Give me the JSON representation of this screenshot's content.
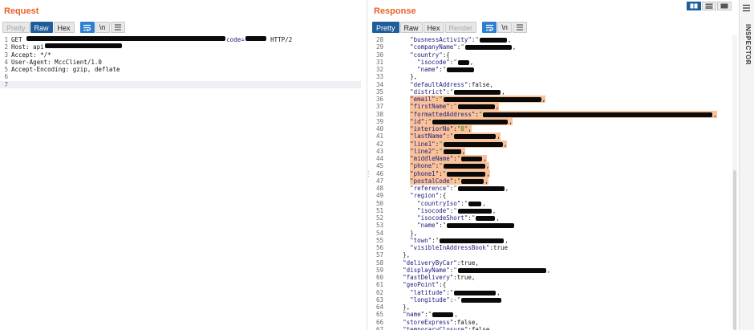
{
  "request": {
    "title": "Request",
    "tabs": {
      "pretty": "Pretty",
      "raw": "Raw",
      "hex": "Hex",
      "newline": "\\n"
    },
    "lines": [
      {
        "n": "1",
        "a": "GET ",
        "b": "code=",
        "c": " HTTP/2"
      },
      {
        "n": "2",
        "a": "Host: api"
      },
      {
        "n": "3",
        "a": "Accept: */*"
      },
      {
        "n": "4",
        "a": "User-Agent: MccClient/1.0"
      },
      {
        "n": "5",
        "a": "Accept-Encoding: gzip, deflate"
      },
      {
        "n": "6",
        "a": ""
      },
      {
        "n": "7",
        "a": ""
      }
    ]
  },
  "response": {
    "title": "Response",
    "tabs": {
      "pretty": "Pretty",
      "raw": "Raw",
      "hex": "Hex",
      "render": "Render",
      "newline": "\\n"
    },
    "lines": [
      {
        "n": "28",
        "indent": "      ",
        "k": "\"busnessActivity\"",
        "sep": ":",
        "r": 34,
        "e": ","
      },
      {
        "n": "29",
        "indent": "      ",
        "k": "\"companyName\"",
        "sep": ":",
        "r": 58,
        "e": ","
      },
      {
        "n": "30",
        "indent": "      ",
        "k": "\"country\"",
        "sep": ":{",
        "r": 0,
        "e": ""
      },
      {
        "n": "31",
        "indent": "        ",
        "k": "\"isocode\"",
        "sep": ":",
        "r": 14,
        "e": ","
      },
      {
        "n": "32",
        "indent": "        ",
        "k": "\"name\"",
        "sep": ":",
        "r": 34,
        "e": ""
      },
      {
        "n": "33",
        "indent": "      ",
        "k": "",
        "sep": "},",
        "r": 0,
        "e": ""
      },
      {
        "n": "34",
        "indent": "      ",
        "k": "\"defaultAddress\"",
        "sep": ":false,",
        "r": 0,
        "e": ""
      },
      {
        "n": "35",
        "indent": "      ",
        "k": "\"district\"",
        "sep": ":",
        "r": 58,
        "e": ","
      },
      {
        "n": "36",
        "indent": "      ",
        "k": "\"email\"",
        "sep": ":",
        "r": 122,
        "e": ",",
        "hl": true
      },
      {
        "n": "37",
        "indent": "      ",
        "k": "\"firstName\"",
        "sep": ":",
        "r": 46,
        "e": ",",
        "hl": true
      },
      {
        "n": "38",
        "indent": "      ",
        "k": "\"formattedAddress\"",
        "sep": ":",
        "r": 286,
        "e": ",",
        "hl": true
      },
      {
        "n": "39",
        "indent": "      ",
        "k": "\"id\"",
        "sep": ":",
        "r": 94,
        "e": ",",
        "hl": true
      },
      {
        "n": "40",
        "indent": "      ",
        "k": "\"interiorNo\"",
        "sep": ":",
        "v": "\"0\"",
        "r": 0,
        "e": ",",
        "hl": true
      },
      {
        "n": "41",
        "indent": "      ",
        "k": "\"lastName\"",
        "sep": ":",
        "r": 52,
        "e": ",",
        "hl": true
      },
      {
        "n": "42",
        "indent": "      ",
        "k": "\"line1\"",
        "sep": ":",
        "r": 74,
        "e": ",",
        "hl": true
      },
      {
        "n": "43",
        "indent": "      ",
        "k": "\"line2\"",
        "sep": ":",
        "r": 22,
        "e": ",",
        "hl": true
      },
      {
        "n": "44",
        "indent": "      ",
        "k": "\"middleName\"",
        "sep": ":",
        "r": 26,
        "e": ",",
        "hl": true
      },
      {
        "n": "45",
        "indent": "      ",
        "k": "\"phone\"",
        "sep": ":",
        "r": 52,
        "e": ",",
        "hl": true
      },
      {
        "n": "46",
        "indent": "      ",
        "k": "\"phone1\"",
        "sep": ":",
        "r": 48,
        "e": ",",
        "hl": true
      },
      {
        "n": "47",
        "indent": "      ",
        "k": "\"postalCode\"",
        "sep": ":",
        "r": 28,
        "e": ",",
        "hl": true
      },
      {
        "n": "48",
        "indent": "      ",
        "k": "\"reference\"",
        "sep": ":",
        "r": 58,
        "e": ","
      },
      {
        "n": "49",
        "indent": "      ",
        "k": "\"region\"",
        "sep": ":{",
        "r": 0,
        "e": ""
      },
      {
        "n": "50",
        "indent": "        ",
        "k": "\"countryIso\"",
        "sep": ":",
        "r": 16,
        "e": ","
      },
      {
        "n": "51",
        "indent": "        ",
        "k": "\"isocode\"",
        "sep": ":",
        "r": 42,
        "e": ","
      },
      {
        "n": "52",
        "indent": "        ",
        "k": "\"isocodeShort\"",
        "sep": ":",
        "r": 24,
        "e": ","
      },
      {
        "n": "53",
        "indent": "        ",
        "k": "\"name\"",
        "sep": ":",
        "r": 84,
        "e": ""
      },
      {
        "n": "54",
        "indent": "      ",
        "k": "",
        "sep": "},",
        "r": 0,
        "e": ""
      },
      {
        "n": "55",
        "indent": "      ",
        "k": "\"town\"",
        "sep": ":",
        "r": 80,
        "e": ","
      },
      {
        "n": "56",
        "indent": "      ",
        "k": "\"visibleInAddressBook\"",
        "sep": ":true",
        "r": 0,
        "e": ""
      },
      {
        "n": "57",
        "indent": "    ",
        "k": "",
        "sep": "},",
        "r": 0,
        "e": ""
      },
      {
        "n": "58",
        "indent": "    ",
        "k": "\"deliveryByCar\"",
        "sep": ":true,",
        "r": 0,
        "e": ""
      },
      {
        "n": "59",
        "indent": "    ",
        "k": "\"displayName\"",
        "sep": ":",
        "r": 110,
        "e": ","
      },
      {
        "n": "60",
        "indent": "    ",
        "k": "\"fastDelivery\"",
        "sep": ":true,",
        "r": 0,
        "e": ""
      },
      {
        "n": "61",
        "indent": "    ",
        "k": "\"geoPoint\"",
        "sep": ":{",
        "r": 0,
        "e": ""
      },
      {
        "n": "62",
        "indent": "      ",
        "k": "\"latitude\"",
        "sep": ":",
        "r": 52,
        "e": ","
      },
      {
        "n": "63",
        "indent": "      ",
        "k": "\"longitude\"",
        "sep": ":-",
        "r": 50,
        "e": ""
      },
      {
        "n": "64",
        "indent": "    ",
        "k": "",
        "sep": "},",
        "r": 0,
        "e": ""
      },
      {
        "n": "65",
        "indent": "    ",
        "k": "\"name\"",
        "sep": ":",
        "r": 26,
        "e": ","
      },
      {
        "n": "66",
        "indent": "    ",
        "k": "\"storeExpress\"",
        "sep": ":false,",
        "r": 0,
        "e": ""
      },
      {
        "n": "67",
        "indent": "    ",
        "k": "\"temporaryClosure\"",
        "sep": ":false",
        "r": 0,
        "e": ""
      }
    ]
  },
  "inspector": {
    "label": "INSPECTOR"
  },
  "colors": {
    "title": "#e8602c",
    "active_tab": "#1f5e9a",
    "highlight": "#f9c29a",
    "redaction": "#0a0a0a"
  },
  "icons": {
    "wrap": "word-wrap-icon",
    "menu": "hamburger-menu-icon",
    "layout": [
      "split-horizontal-icon",
      "split-vertical-icon",
      "single-pane-icon"
    ]
  }
}
